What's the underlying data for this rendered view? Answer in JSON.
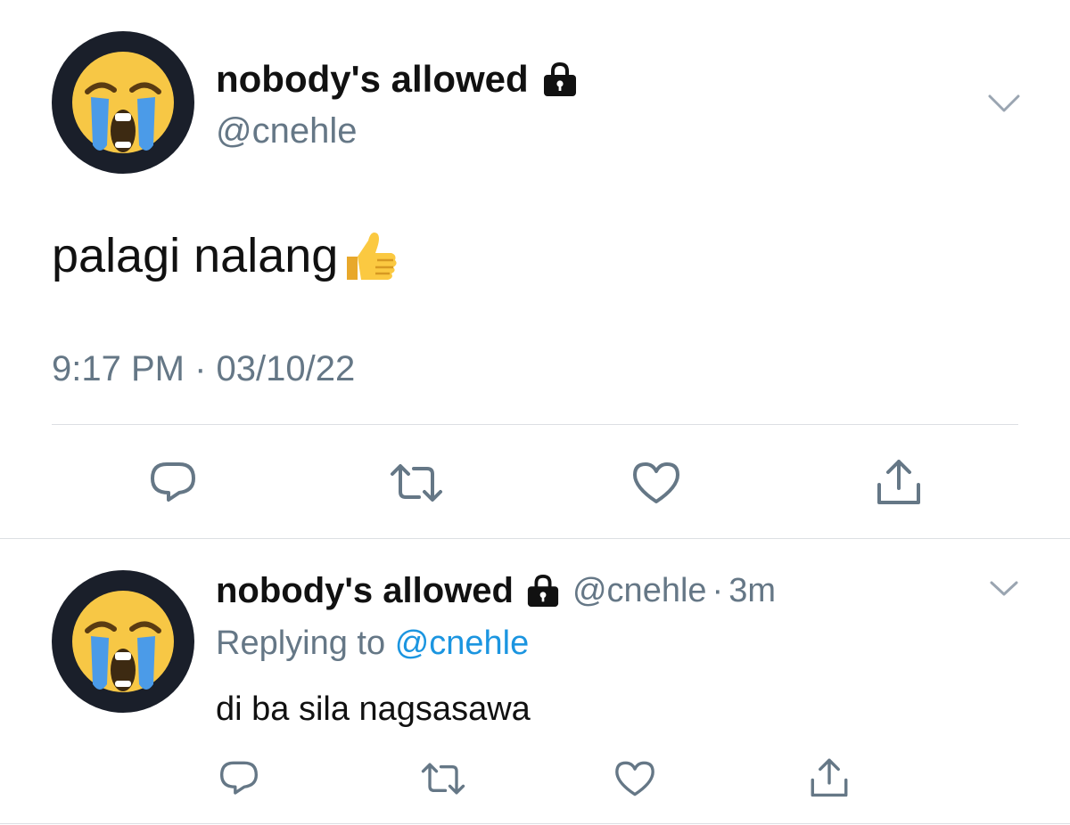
{
  "main_tweet": {
    "display_name": "nobody's allowed",
    "handle": "@cnehle",
    "text": "palagi nalang",
    "timestamp": "9:17 PM · 03/10/22",
    "avatar_icon": "loudly-crying-face-icon",
    "text_emoji_icon": "thumbs-up-icon",
    "locked_icon": "lock-icon"
  },
  "reply_tweet": {
    "display_name": "nobody's allowed",
    "handle": "@cnehle",
    "separator": "·",
    "time_ago": "3m",
    "replying_prefix": "Replying to",
    "replying_handle": "@cnehle",
    "text": "di ba sila nagsasawa",
    "avatar_icon": "loudly-crying-face-icon",
    "locked_icon": "lock-icon"
  },
  "actions": [
    "reply-icon",
    "retweet-icon",
    "like-icon",
    "share-icon"
  ],
  "colors": {
    "text": "#14171a",
    "muted": "#657786",
    "link": "#1b95e0",
    "divider": "#dcdfe3",
    "avatar_bg": "#1a1f2a"
  }
}
